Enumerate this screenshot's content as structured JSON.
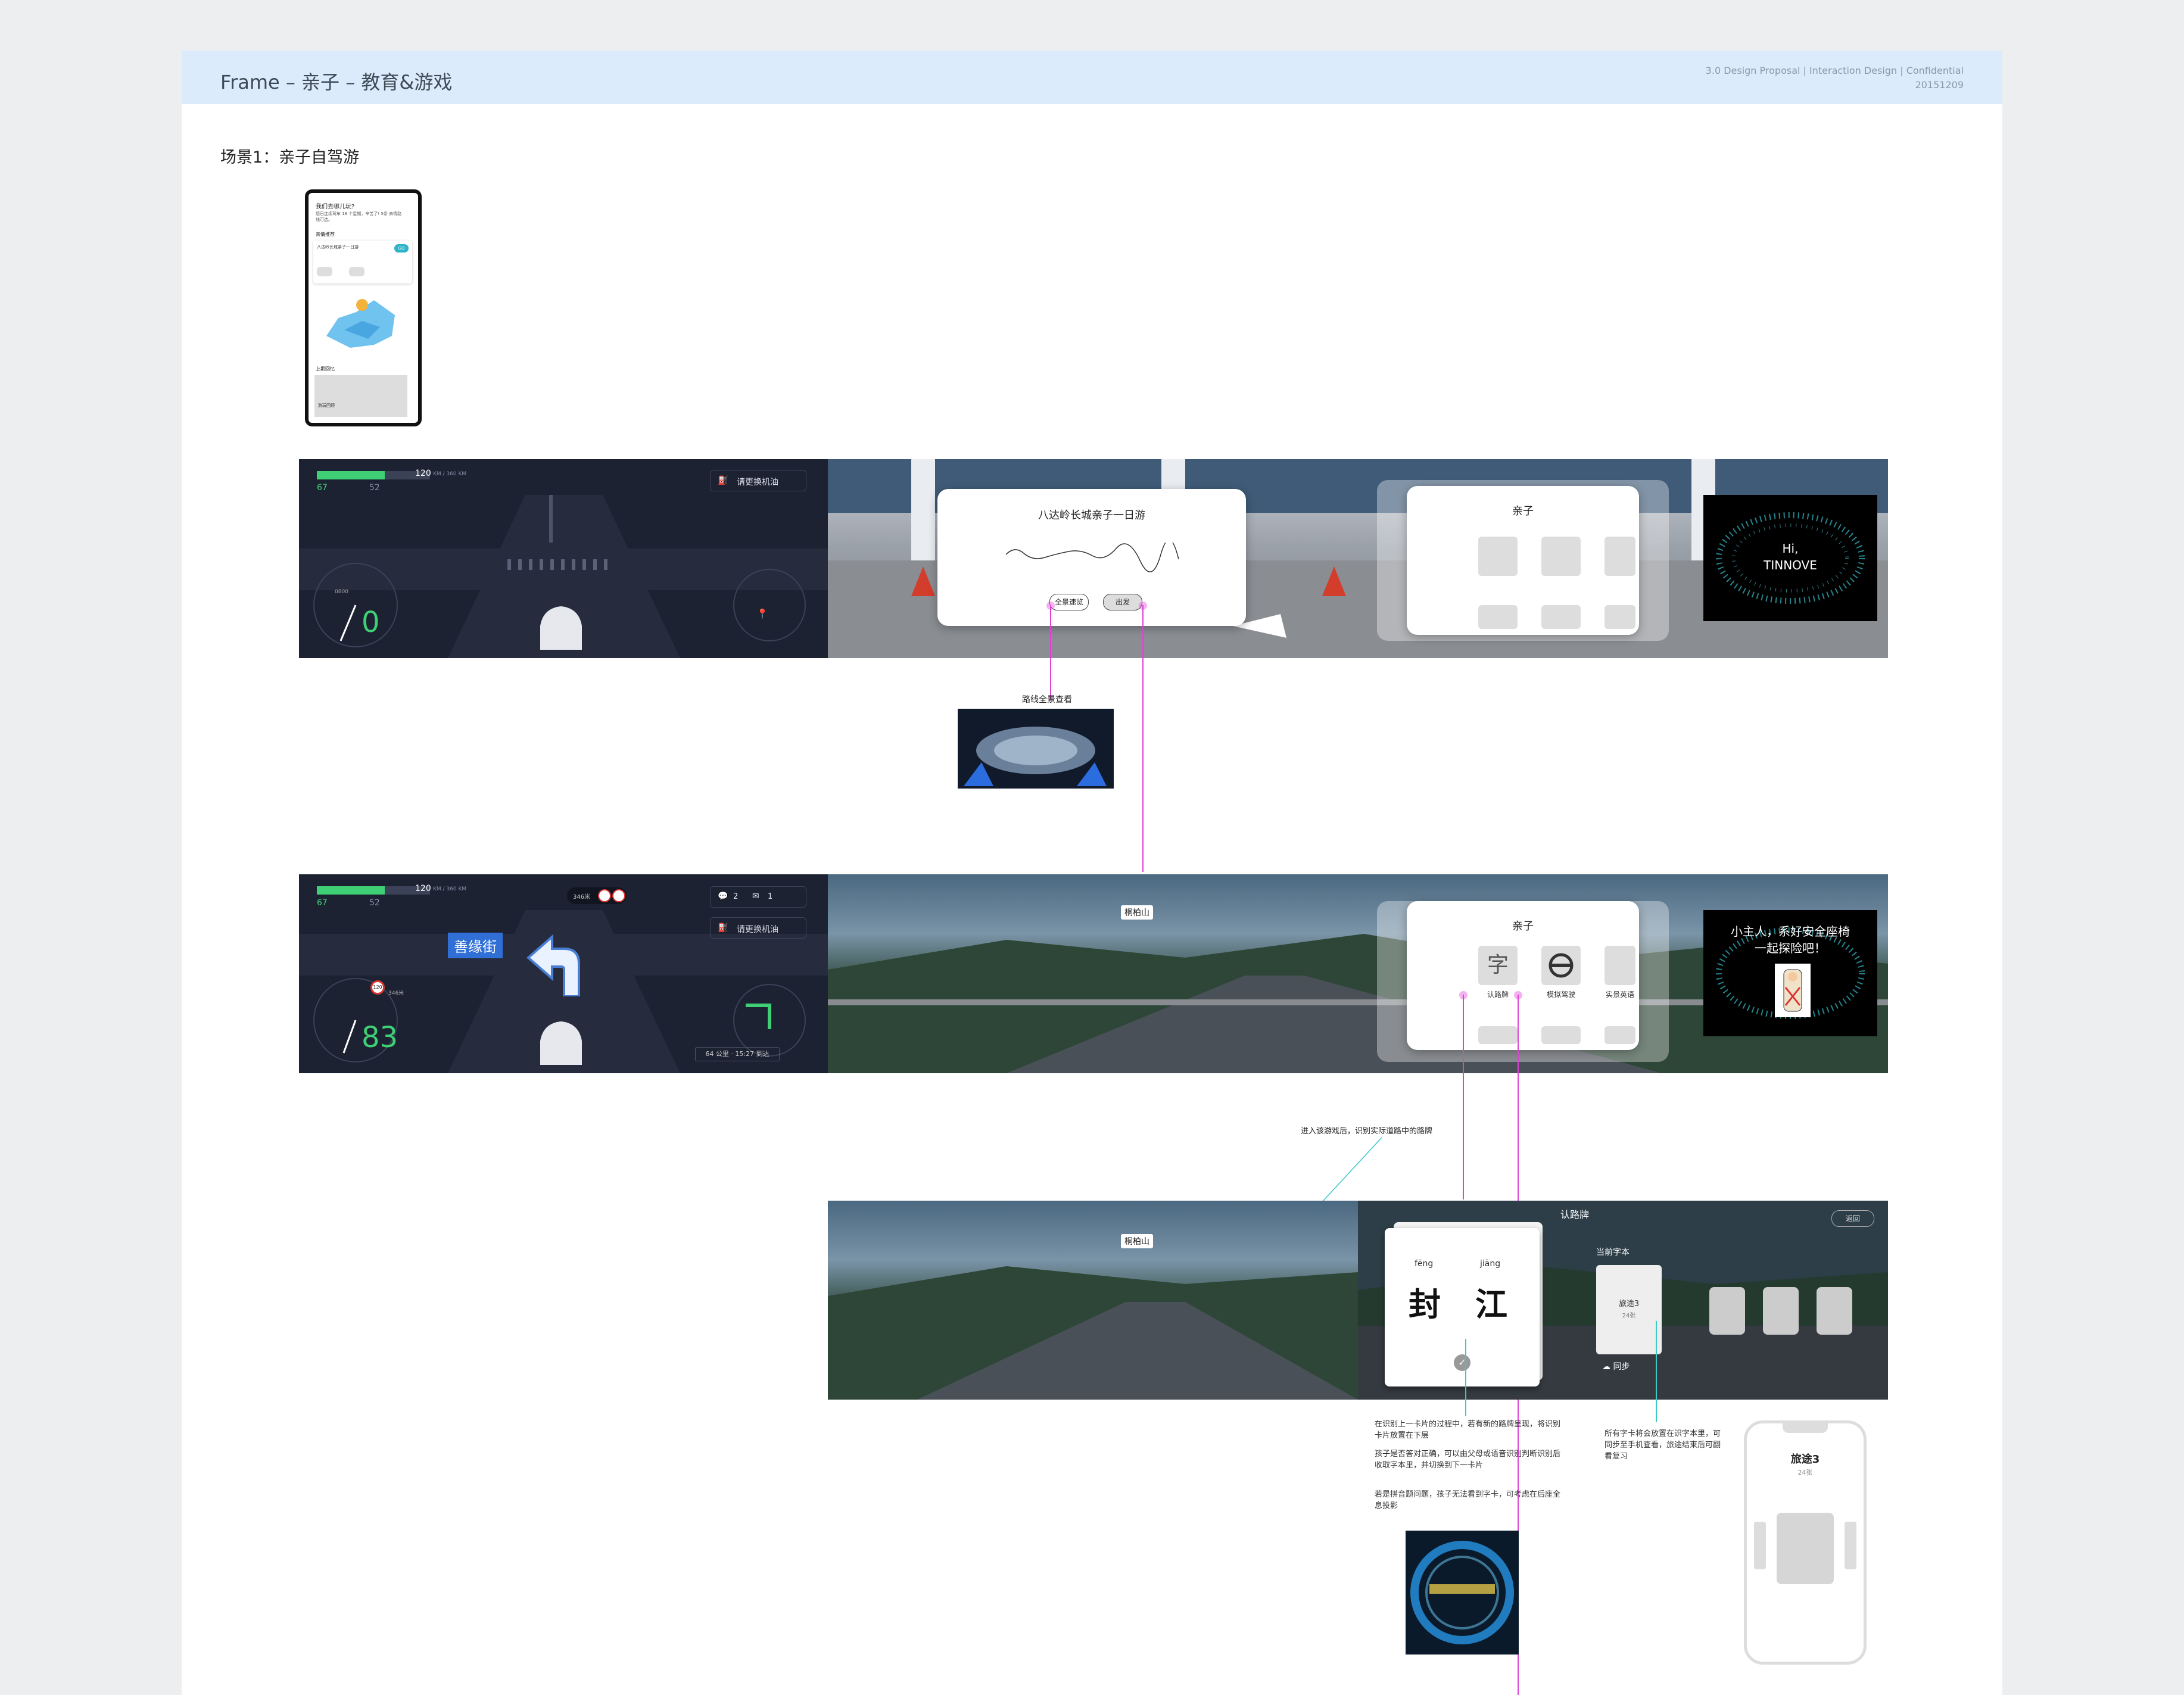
{
  "header": {
    "title": "Frame – 亲子 – 教育&游戏",
    "meta_line1": "3.0 Design Proposal  |  Interaction Design  |  Confidential",
    "meta_date": "20151209"
  },
  "scene_title": "场景1：亲子自驾游",
  "phone": {
    "question": "我们去哪儿玩?",
    "subtitle": "您已连续驾车 18 个星期，辛苦了! 5条 亲情路线可选。",
    "section": "亲情推荐",
    "trip": "八达岭长城亲子一日游",
    "button": "GO",
    "footer_label": "上期回忆",
    "footer_item": "游玩回顾"
  },
  "cluster1": {
    "range": "120",
    "range_unit": "KM / 360 KM",
    "battery": "67",
    "temp": "52",
    "speed": "0",
    "gauge_label": "0800",
    "fuel_prompt": "请更换机油"
  },
  "route_dialog": {
    "title": "八达岭长城亲子一日游",
    "btn_overview": "全景速览",
    "btn_go": "出发"
  },
  "family_panel_1": {
    "title": "亲子"
  },
  "welcome_screen_1": {
    "line1": "Hi,",
    "line2": "TINNOVE"
  },
  "annotation_overview": "路线全景查看",
  "cluster2": {
    "range": "120",
    "range_unit": "KM / 360 KM",
    "battery": "67",
    "temp": "52",
    "speed": "83",
    "limit": "120",
    "street": "善缘街",
    "distance": "346米",
    "msg_count": "2",
    "mail_count": "1",
    "fuel_prompt": "请更换机油",
    "eta": "64 公里 · 15:27 到达",
    "turn_label": "346米"
  },
  "road_sign_1": "桐柏山",
  "family_panel_2": {
    "title": "亲子",
    "items": [
      "认路牌",
      "模拟驾驶",
      "实景英语"
    ]
  },
  "welcome_screen_2": {
    "line1": "小主人，系好安全座椅",
    "line2": "一起探险吧！"
  },
  "annotation_enter": "进入该游戏后，识别实际道路中的路牌",
  "road_sign_2": "桐柏山",
  "word_card": {
    "header": "认路牌",
    "back": "返回",
    "pinyin1": "fēng",
    "pinyin2": "jiāng",
    "char1": "封",
    "char2": "江",
    "current_label": "当前字本",
    "book_title": "旅途3",
    "book_count": "24张",
    "sync": "同步"
  },
  "notes_left": [
    "在识别上一卡片的过程中，若有新的路牌呈现，将识别卡片放置在下层",
    "孩子是否答对正确，可以由父母或语音识别判断识别后收取字本里，并切换到下一卡片",
    "若是拼音题问题，孩子无法看到字卡，可考虑在后座全息投影"
  ],
  "notes_right": "所有字卡将会放置在识字本里，可同步至手机查看，旅途结束后可翻看复习",
  "mobile": {
    "title": "旅途3",
    "count": "24张"
  }
}
